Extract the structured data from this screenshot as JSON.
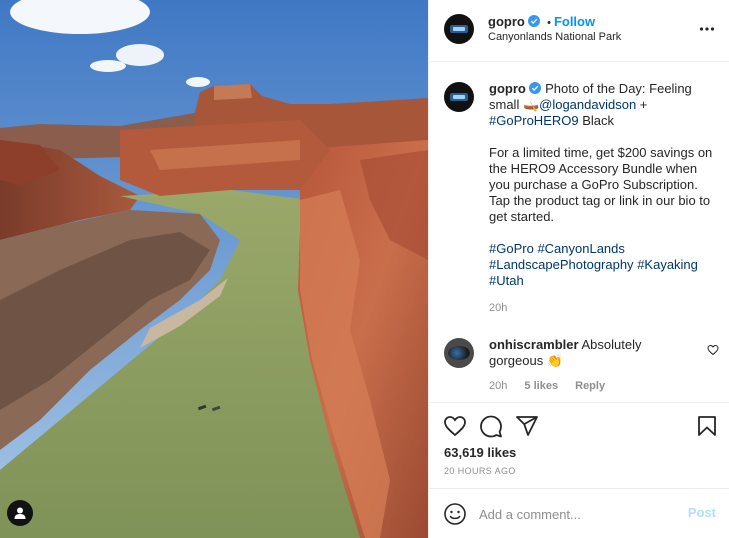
{
  "post": {
    "username": "gopro",
    "follow_label": "Follow",
    "dot": "•",
    "location": "Canyonlands National Park",
    "more_icon": "more-horizontal-icon"
  },
  "caption": {
    "username": "gopro",
    "text_1": "Photo of the Day: Feeling small ",
    "emoji_kayak": "🛶",
    "mention": "@logandavidson",
    "plus": " +",
    "hashtag_product": "#GoProHERO9",
    "text_2": " Black",
    "paragraph_2": "For a limited time, get $200 savings on the HERO9 Accessory Bundle when you purchase a GoPro Subscription. Tap the product tag or link in our bio to get started.",
    "hashtags": [
      "#GoPro",
      "#CanyonLands",
      "#LandscapePhotography",
      "#Kayaking",
      "#Utah"
    ],
    "time": "20h"
  },
  "comment": {
    "username": "onhiscrambler",
    "text": "Absolutely gorgeous",
    "emoji": "👏",
    "time": "20h",
    "likes": "5 likes",
    "reply_label": "Reply"
  },
  "actions": {
    "likes_count": "63,619 likes",
    "time_ago": "20 HOURS AGO"
  },
  "add_comment": {
    "placeholder": "Add a comment...",
    "post_label": "Post"
  },
  "colors": {
    "accent": "#0095f6",
    "hashtag": "#00376b",
    "post_disabled": "#b2dffc",
    "muted": "#8e8e8e"
  }
}
